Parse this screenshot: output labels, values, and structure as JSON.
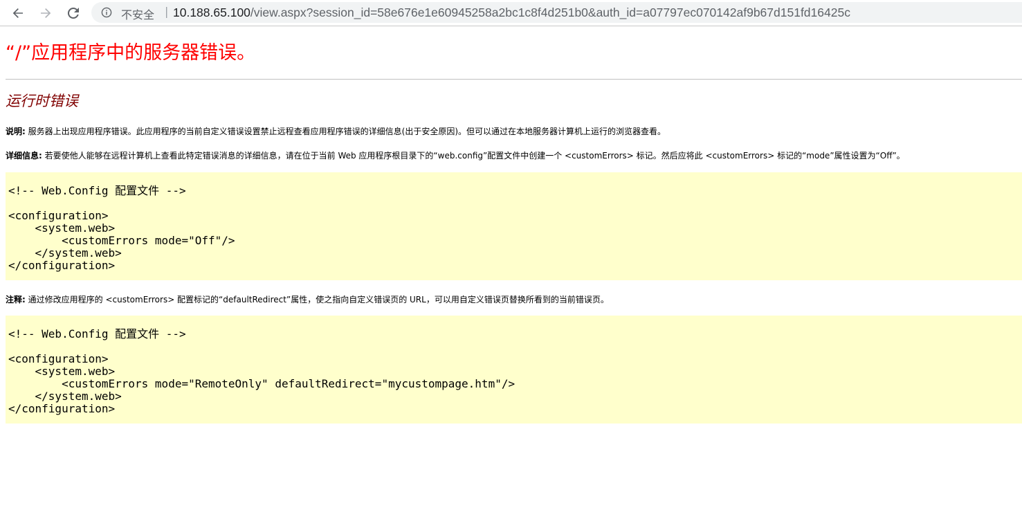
{
  "browser": {
    "security_label": "不安全",
    "separator": "|",
    "url_host": "10.188.65.100",
    "url_path": "/view.aspx?session_id=58e676e1e60945258a2bc1c8f4d251b0&auth_id=a07797ec070142af9b67d151fd16425c",
    "icons": [
      "back-arrow-icon",
      "forward-arrow-icon",
      "reload-icon",
      "info-icon"
    ]
  },
  "page": {
    "title": "“/”应用程序中的服务器错误。",
    "subtitle": "运行时错误",
    "description_label": "说明:",
    "description_text": " 服务器上出现应用程序错误。此应用程序的当前自定义错误设置禁止远程查看应用程序错误的详细信息(出于安全原因)。但可以通过在本地服务器计算机上运行的浏览器查看。",
    "details_label": "详细信息:",
    "details_text": " 若要使他人能够在远程计算机上查看此特定错误消息的详细信息，请在位于当前 Web 应用程序根目录下的“web.config”配置文件中创建一个 <customErrors> 标记。然后应将此 <customErrors> 标记的“mode”属性设置为“Off”。",
    "code_block_1": "\n<!-- Web.Config 配置文件 -->\n\n<configuration>\n    <system.web>\n        <customErrors mode=\"Off\"/>\n    </system.web>\n</configuration>",
    "notes_label": "注释:",
    "notes_text": " 通过修改应用程序的 <customErrors> 配置标记的“defaultRedirect”属性，使之指向自定义错误页的 URL，可以用自定义错误页替换所看到的当前错误页。",
    "code_block_2": "\n<!-- Web.Config 配置文件 -->\n\n<configuration>\n    <system.web>\n        <customErrors mode=\"RemoteOnly\" defaultRedirect=\"mycustompage.htm\"/>\n    </system.web>\n</configuration>"
  },
  "colors": {
    "title": "#ff0000",
    "subtitle": "#800000",
    "code_background": "#ffffcc"
  }
}
